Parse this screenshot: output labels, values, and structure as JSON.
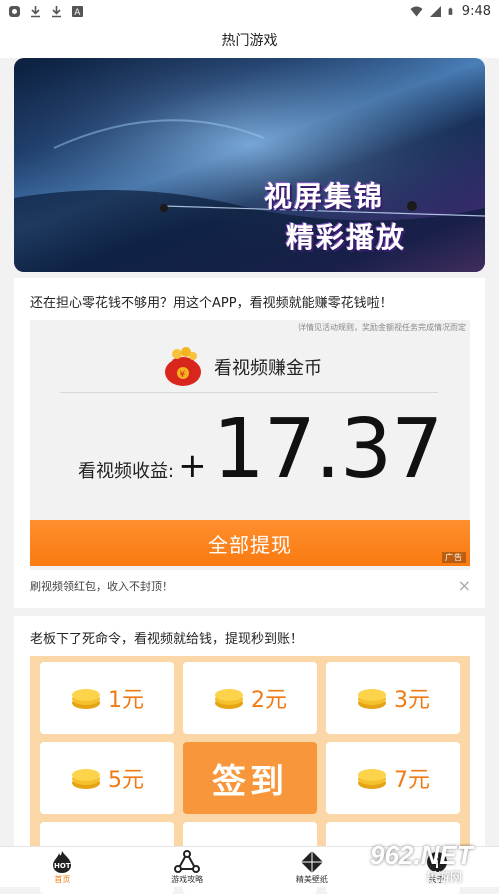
{
  "status_bar": {
    "time": "9:48",
    "icons_left": [
      "notification-icon",
      "download-icon",
      "download-icon",
      "app-icon"
    ],
    "icons_right": [
      "wifi-icon",
      "signal-icon",
      "battery-icon"
    ]
  },
  "header": {
    "title": "热门游戏"
  },
  "banner": {
    "line1": "视屏集锦",
    "line2": "精彩播放"
  },
  "reward_card": {
    "headline": "还在担心零花钱不够用？用这个APP，看视频就能赚零花钱啦！",
    "ad_note": "详情见活动规则，奖励金额视任务完成情况而定",
    "ad_title": "看视频赚金币",
    "earn_label": "看视频收益:",
    "earn_plus": "+",
    "earn_value": "17.37",
    "withdraw_label": "全部提现",
    "ad_tag": "广告",
    "sub_text": "刷视频领红包，收入不封顶！",
    "close_symbol": "×"
  },
  "signin_card": {
    "headline": "老板下了死命令，看视频就给钱，提现秒到账！",
    "cells": [
      {
        "label": "1元"
      },
      {
        "label": "2元"
      },
      {
        "label": "3元"
      },
      {
        "label": "5元"
      },
      {
        "label": "签到"
      },
      {
        "label": "7元"
      }
    ]
  },
  "bottom_nav": {
    "items": [
      {
        "label": "首页",
        "icon": "hot-flame-icon",
        "active": true
      },
      {
        "label": "游戏攻略",
        "icon": "share-nodes-icon",
        "active": false
      },
      {
        "label": "精美壁纸",
        "icon": "diamond-icon",
        "active": false
      },
      {
        "label": "关于",
        "icon": "info-icon",
        "active": false
      }
    ]
  },
  "watermark": {
    "main": "962.NET",
    "sub": "乐游网"
  },
  "colors": {
    "accent": "#f97a10",
    "grid_bg": "#fbd7a7",
    "signin_bg": "#f7963a"
  }
}
